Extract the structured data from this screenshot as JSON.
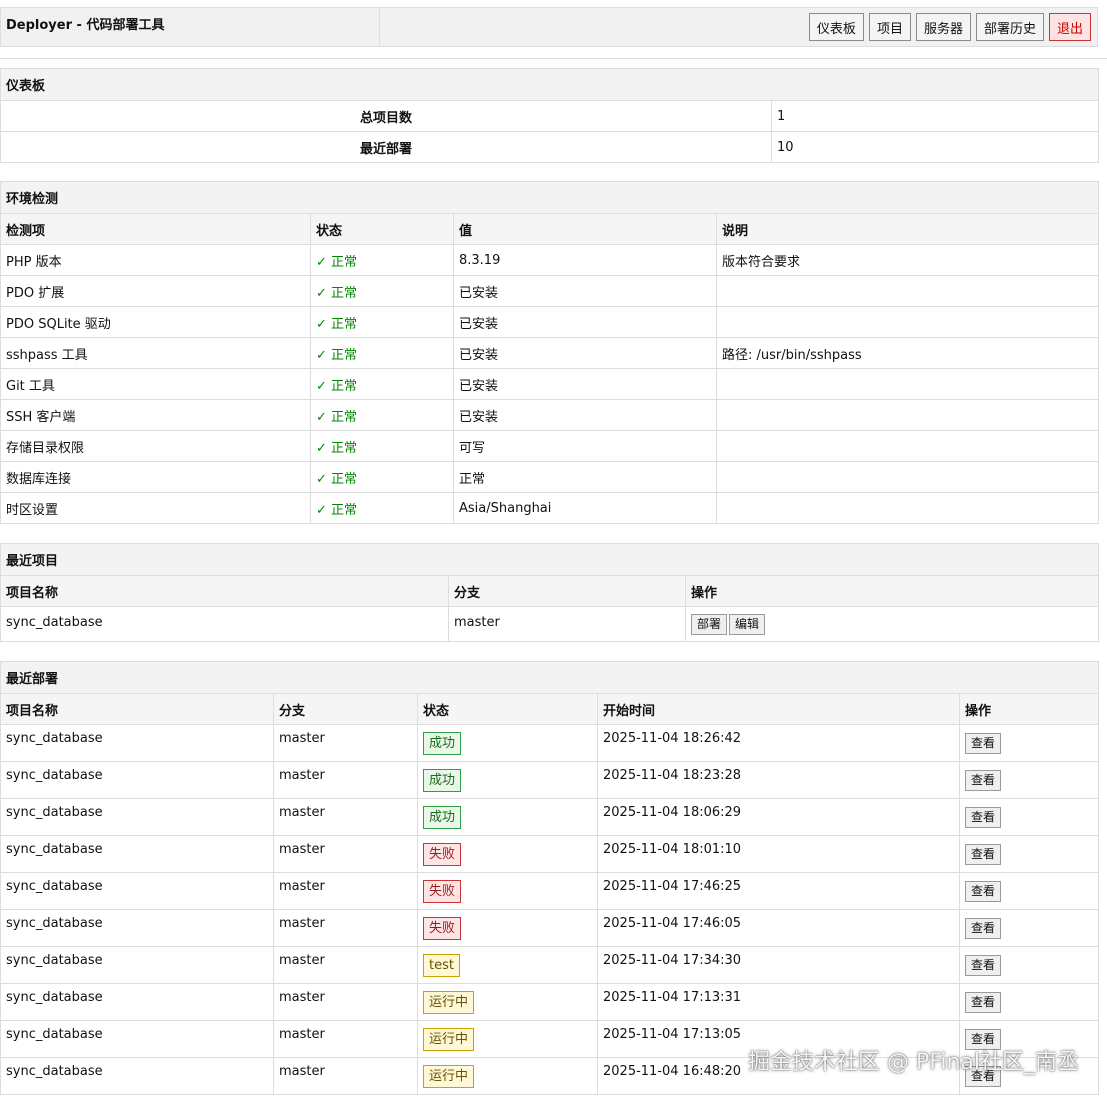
{
  "header": {
    "title": "Deployer - 代码部署工具",
    "nav": [
      {
        "label": "仪表板",
        "name": "nav-dashboard-button",
        "danger": false
      },
      {
        "label": "项目",
        "name": "nav-projects-button",
        "danger": false
      },
      {
        "label": "服务器",
        "name": "nav-servers-button",
        "danger": false
      },
      {
        "label": "部署历史",
        "name": "nav-history-button",
        "danger": false
      },
      {
        "label": "退出",
        "name": "logout-button",
        "danger": true
      }
    ]
  },
  "dashboard": {
    "title": "仪表板",
    "rows": [
      {
        "label": "总项目数",
        "value": "1"
      },
      {
        "label": "最近部署",
        "value": "10"
      }
    ]
  },
  "env": {
    "title": "环境检测",
    "columns": [
      "检测项",
      "状态",
      "值",
      "说明"
    ],
    "rows": [
      {
        "item": "PHP 版本",
        "status": "✓ 正常",
        "value": "8.3.19",
        "note": "版本符合要求"
      },
      {
        "item": "PDO 扩展",
        "status": "✓ 正常",
        "value": "已安装",
        "note": ""
      },
      {
        "item": "PDO SQLite 驱动",
        "status": "✓ 正常",
        "value": "已安装",
        "note": ""
      },
      {
        "item": "sshpass 工具",
        "status": "✓ 正常",
        "value": "已安装",
        "note": "路径: /usr/bin/sshpass"
      },
      {
        "item": "Git 工具",
        "status": "✓ 正常",
        "value": "已安装",
        "note": ""
      },
      {
        "item": "SSH 客户端",
        "status": "✓ 正常",
        "value": "已安装",
        "note": ""
      },
      {
        "item": "存储目录权限",
        "status": "✓ 正常",
        "value": "可写",
        "note": ""
      },
      {
        "item": "数据库连接",
        "status": "✓ 正常",
        "value": "正常",
        "note": ""
      },
      {
        "item": "时区设置",
        "status": "✓ 正常",
        "value": "Asia/Shanghai",
        "note": ""
      }
    ]
  },
  "recent_projects": {
    "title": "最近项目",
    "columns": [
      "项目名称",
      "分支",
      "操作"
    ],
    "rows": [
      {
        "name": "sync_database",
        "branch": "master",
        "deploy_label": "部署",
        "edit_label": "编辑"
      }
    ]
  },
  "recent_deploys": {
    "title": "最近部署",
    "columns": [
      "项目名称",
      "分支",
      "状态",
      "开始时间",
      "操作"
    ],
    "view_label": "查看",
    "rows": [
      {
        "name": "sync_database",
        "branch": "master",
        "status": "成功",
        "kind": "success",
        "time": "2025-11-04 18:26:42"
      },
      {
        "name": "sync_database",
        "branch": "master",
        "status": "成功",
        "kind": "success",
        "time": "2025-11-04 18:23:28"
      },
      {
        "name": "sync_database",
        "branch": "master",
        "status": "成功",
        "kind": "success",
        "time": "2025-11-04 18:06:29"
      },
      {
        "name": "sync_database",
        "branch": "master",
        "status": "失败",
        "kind": "failed",
        "time": "2025-11-04 18:01:10"
      },
      {
        "name": "sync_database",
        "branch": "master",
        "status": "失败",
        "kind": "failed",
        "time": "2025-11-04 17:46:25"
      },
      {
        "name": "sync_database",
        "branch": "master",
        "status": "失败",
        "kind": "failed",
        "time": "2025-11-04 17:46:05"
      },
      {
        "name": "sync_database",
        "branch": "master",
        "status": "test",
        "kind": "running",
        "time": "2025-11-04 17:34:30"
      },
      {
        "name": "sync_database",
        "branch": "master",
        "status": "运行中",
        "kind": "running",
        "time": "2025-11-04 17:13:31"
      },
      {
        "name": "sync_database",
        "branch": "master",
        "status": "运行中",
        "kind": "running",
        "time": "2025-11-04 17:13:05"
      },
      {
        "name": "sync_database",
        "branch": "master",
        "status": "运行中",
        "kind": "running",
        "time": "2025-11-04 16:48:20"
      }
    ]
  },
  "watermark": "掘金技术社区 @ PFinal社区_南丞"
}
